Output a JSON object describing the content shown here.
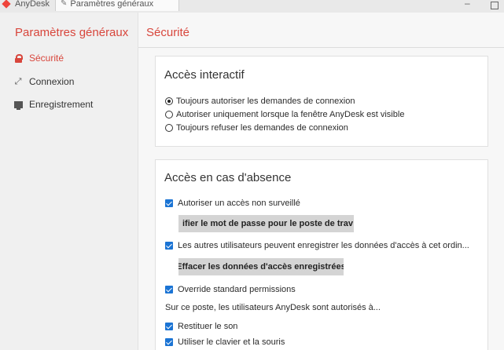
{
  "titlebar": {
    "app_tab": "AnyDesk",
    "settings_tab": "Paramètres généraux",
    "minimize": "–"
  },
  "sidebar": {
    "title": "Paramètres généraux",
    "items": [
      {
        "label": "Sécurité",
        "icon": "lock-icon",
        "active": true
      },
      {
        "label": "Connexion",
        "icon": "connection-icon",
        "active": false
      },
      {
        "label": "Enregistrement",
        "icon": "recording-icon",
        "active": false
      }
    ]
  },
  "main": {
    "title": "Sécurité",
    "interactive_access": {
      "title": "Accès interactif",
      "options": [
        {
          "label": "Toujours autoriser les demandes de connexion",
          "selected": true
        },
        {
          "label": "Autoriser uniquement lorsque la fenêtre AnyDesk est visible",
          "selected": false
        },
        {
          "label": "Toujours refuser les demandes de connexion",
          "selected": false
        }
      ]
    },
    "unattended_access": {
      "title": "Accès en cas d'absence",
      "allow_unattended": {
        "label": "Autoriser un accès non surveillé",
        "checked": true
      },
      "change_password_button": "ifier le mot de passe pour le poste de trav",
      "save_credentials": {
        "label": "Les autres utilisateurs peuvent enregistrer les données d'accès à cet ordin...",
        "checked": true
      },
      "clear_credentials_button": "Effacer les données d'accès enregistrées",
      "override_permissions": {
        "label": "Override standard permissions",
        "checked": true
      },
      "permissions_intro": "Sur ce poste, les utilisateurs AnyDesk sont autorisés à...",
      "permissions": [
        {
          "label": "Restituer le son",
          "checked": true
        },
        {
          "label": "Utiliser le clavier et la souris",
          "checked": true
        }
      ]
    }
  },
  "colors": {
    "accent": "#d8463c",
    "checkbox": "#1b74d4"
  }
}
